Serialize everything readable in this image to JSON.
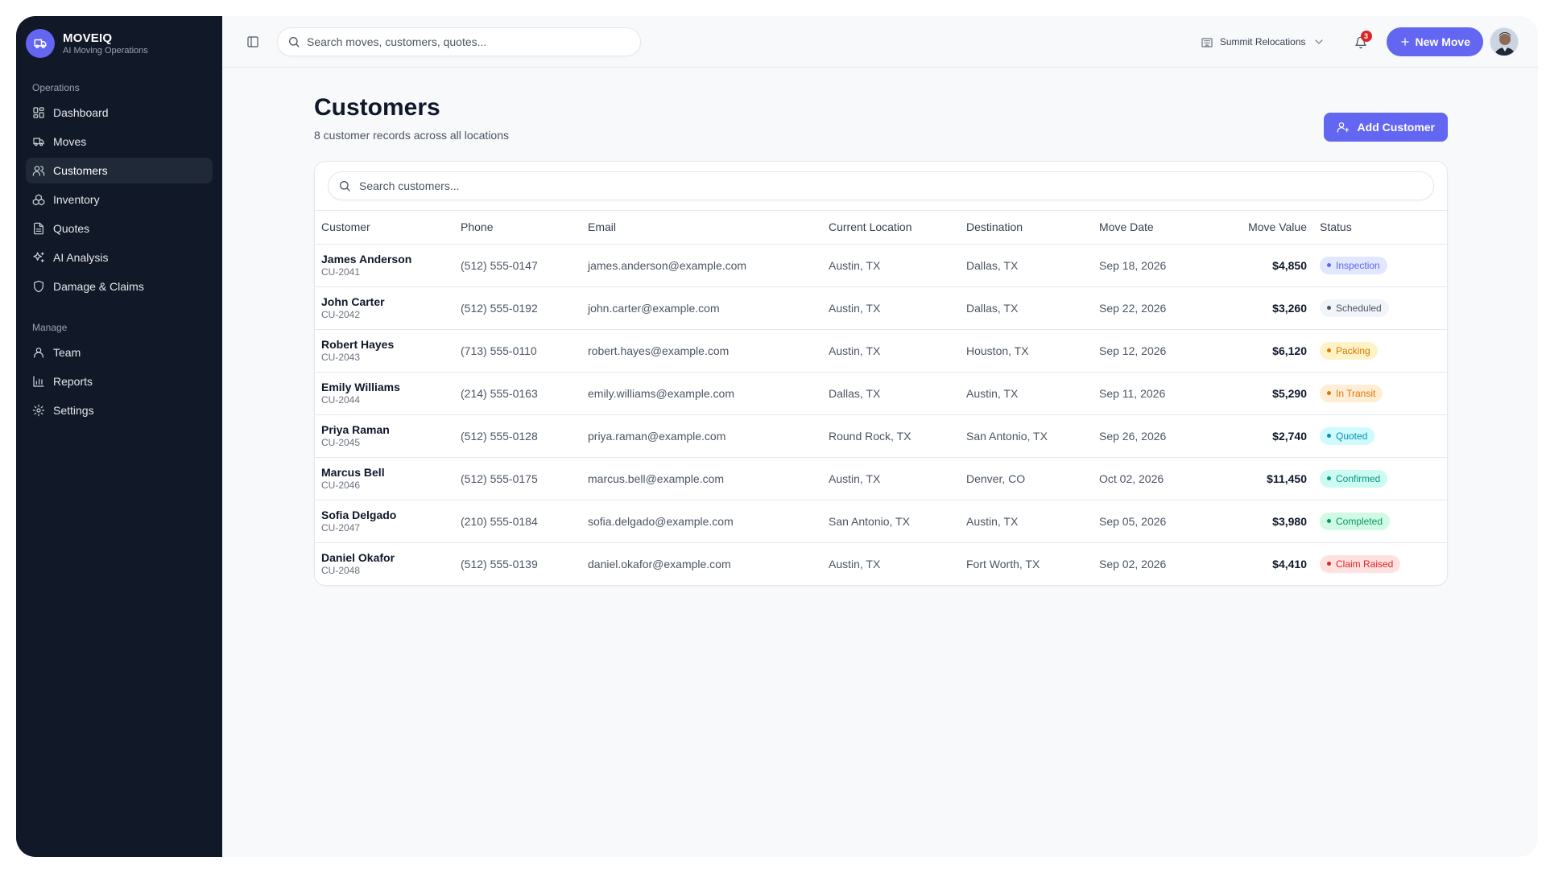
{
  "brand": {
    "name": "MOVEIQ",
    "subtitle": "AI Moving Operations"
  },
  "sidebar": {
    "operations_label": "Operations",
    "manage_label": "Manage",
    "operations": [
      {
        "label": "Dashboard",
        "icon": "dashboard-icon"
      },
      {
        "label": "Moves",
        "icon": "truck-icon"
      },
      {
        "label": "Customers",
        "icon": "users-icon",
        "active": true
      },
      {
        "label": "Inventory",
        "icon": "boxes-icon"
      },
      {
        "label": "Quotes",
        "icon": "document-icon"
      },
      {
        "label": "AI Analysis",
        "icon": "sparkles-icon"
      },
      {
        "label": "Damage & Claims",
        "icon": "shield-icon"
      }
    ],
    "manage": [
      {
        "label": "Team",
        "icon": "user-icon"
      },
      {
        "label": "Reports",
        "icon": "bar-chart-icon"
      },
      {
        "label": "Settings",
        "icon": "gear-icon"
      }
    ]
  },
  "topbar": {
    "search_placeholder": "Search moves, customers, quotes...",
    "org_name": "Summit Relocations",
    "notification_count": "3",
    "new_move_label": "New Move"
  },
  "page": {
    "title": "Customers",
    "subtitle": "8 customer records across all locations",
    "add_button_label": "Add Customer",
    "table_search_placeholder": "Search customers..."
  },
  "table": {
    "columns": [
      "Customer",
      "Phone",
      "Email",
      "Current Location",
      "Destination",
      "Move Date",
      "Move Value",
      "Status"
    ],
    "rows": [
      {
        "name": "James Anderson",
        "id": "CU-2041",
        "phone": "(512) 555-0147",
        "email": "james.anderson@example.com",
        "from": "Austin, TX",
        "to": "Dallas, TX",
        "date": "Sep 18, 2026",
        "value": "$4,850",
        "status": "Inspection",
        "status_color": "#6366f1",
        "status_bg": "#e0e7ff"
      },
      {
        "name": "John Carter",
        "id": "CU-2042",
        "phone": "(512) 555-0192",
        "email": "john.carter@example.com",
        "from": "Austin, TX",
        "to": "Dallas, TX",
        "date": "Sep 22, 2026",
        "value": "$3,260",
        "status": "Scheduled",
        "status_color": "#4b5563",
        "status_bg": "#f1f5f9"
      },
      {
        "name": "Robert Hayes",
        "id": "CU-2043",
        "phone": "(713) 555-0110",
        "email": "robert.hayes@example.com",
        "from": "Austin, TX",
        "to": "Houston, TX",
        "date": "Sep 12, 2026",
        "value": "$6,120",
        "status": "Packing",
        "status_color": "#d97706",
        "status_bg": "#fef3c7"
      },
      {
        "name": "Emily Williams",
        "id": "CU-2044",
        "phone": "(214) 555-0163",
        "email": "emily.williams@example.com",
        "from": "Dallas, TX",
        "to": "Austin, TX",
        "date": "Sep 11, 2026",
        "value": "$5,290",
        "status": "In Transit",
        "status_color": "#d97706",
        "status_bg": "#ffedd5"
      },
      {
        "name": "Priya Raman",
        "id": "CU-2045",
        "phone": "(512) 555-0128",
        "email": "priya.raman@example.com",
        "from": "Round Rock, TX",
        "to": "San Antonio, TX",
        "date": "Sep 26, 2026",
        "value": "$2,740",
        "status": "Quoted",
        "status_color": "#0891b2",
        "status_bg": "#cffafe"
      },
      {
        "name": "Marcus Bell",
        "id": "CU-2046",
        "phone": "(512) 555-0175",
        "email": "marcus.bell@example.com",
        "from": "Austin, TX",
        "to": "Denver, CO",
        "date": "Oct 02, 2026",
        "value": "$11,450",
        "status": "Confirmed",
        "status_color": "#0d9488",
        "status_bg": "#ccfbf1"
      },
      {
        "name": "Sofia Delgado",
        "id": "CU-2047",
        "phone": "(210) 555-0184",
        "email": "sofia.delgado@example.com",
        "from": "San Antonio, TX",
        "to": "Austin, TX",
        "date": "Sep 05, 2026",
        "value": "$3,980",
        "status": "Completed",
        "status_color": "#059669",
        "status_bg": "#d1fae5"
      },
      {
        "name": "Daniel Okafor",
        "id": "CU-2048",
        "phone": "(512) 555-0139",
        "email": "daniel.okafor@example.com",
        "from": "Austin, TX",
        "to": "Fort Worth, TX",
        "date": "Sep 02, 2026",
        "value": "$4,410",
        "status": "Claim Raised",
        "status_color": "#dc2626",
        "status_bg": "#fee2e2"
      }
    ]
  }
}
